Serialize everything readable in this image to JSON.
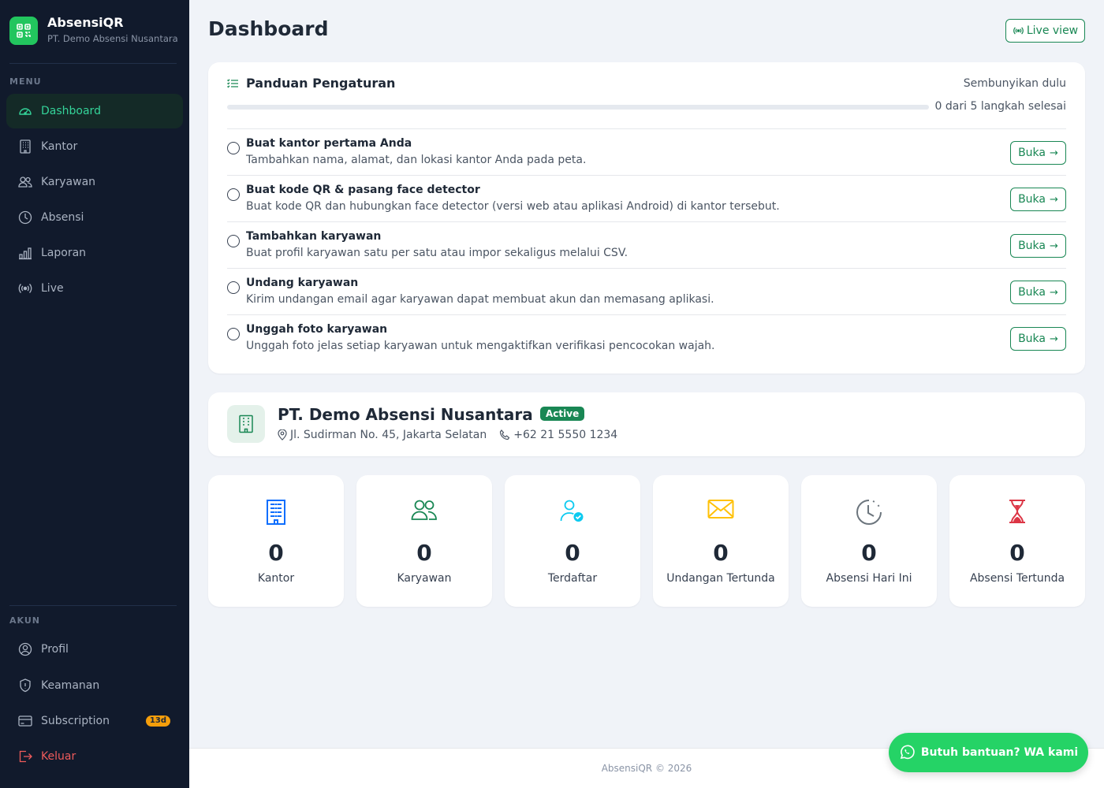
{
  "brand": {
    "name": "AbsensiQR",
    "company": "PT. Demo Absensi Nusantara"
  },
  "sidebar": {
    "menu_label": "MENU",
    "menu": [
      {
        "label": "Dashboard",
        "icon": "speedometer-icon",
        "active": true
      },
      {
        "label": "Kantor",
        "icon": "building-icon"
      },
      {
        "label": "Karyawan",
        "icon": "people-icon"
      },
      {
        "label": "Absensi",
        "icon": "clock-icon"
      },
      {
        "label": "Laporan",
        "icon": "bar-chart-icon"
      },
      {
        "label": "Live",
        "icon": "broadcast-icon"
      }
    ],
    "account_label": "AKUN",
    "account": [
      {
        "label": "Profil",
        "icon": "user-circle-icon"
      },
      {
        "label": "Keamanan",
        "icon": "shield-icon"
      },
      {
        "label": "Subscription",
        "icon": "credit-card-icon",
        "badge": "13d"
      },
      {
        "label": "Keluar",
        "icon": "logout-icon"
      }
    ]
  },
  "header": {
    "title": "Dashboard",
    "live_view_label": "Live view"
  },
  "guide": {
    "title": "Panduan Pengaturan",
    "hide_label": "Sembunyikan dulu",
    "progress_text": "0 dari 5 langkah selesai",
    "progress_fraction": 0,
    "open_label": "Buka",
    "steps": [
      {
        "title": "Buat kantor pertama Anda",
        "desc": "Tambahkan nama, alamat, dan lokasi kantor Anda pada peta."
      },
      {
        "title": "Buat kode QR & pasang face detector",
        "desc": "Buat kode QR dan hubungkan face detector (versi web atau aplikasi Android) di kantor tersebut."
      },
      {
        "title": "Tambahkan karyawan",
        "desc": "Buat profil karyawan satu per satu atau impor sekaligus melalui CSV."
      },
      {
        "title": "Undang karyawan",
        "desc": "Kirim undangan email agar karyawan dapat membuat akun dan memasang aplikasi."
      },
      {
        "title": "Unggah foto karyawan",
        "desc": "Unggah foto jelas setiap karyawan untuk mengaktifkan verifikasi pencocokan wajah."
      }
    ]
  },
  "company": {
    "name": "PT. Demo Absensi Nusantara",
    "status": "Active",
    "address": "Jl. Sudirman No. 45, Jakarta Selatan",
    "phone": "+62 21 5550 1234"
  },
  "stats": [
    {
      "value": "0",
      "label": "Kantor",
      "icon": "building-icon",
      "color": "#0d6efd"
    },
    {
      "value": "0",
      "label": "Karyawan",
      "icon": "people-icon",
      "color": "#198754"
    },
    {
      "value": "0",
      "label": "Terdaftar",
      "icon": "person-check-icon",
      "color": "#0dcaf0"
    },
    {
      "value": "0",
      "label": "Undangan Tertunda",
      "icon": "envelope-icon",
      "color": "#ffc107"
    },
    {
      "value": "0",
      "label": "Absensi Hari Ini",
      "icon": "clock-history-icon",
      "color": "#6c757d"
    },
    {
      "value": "0",
      "label": "Absensi Tertunda",
      "icon": "hourglass-icon",
      "color": "#dc3545"
    }
  ],
  "footer": {
    "text": "AbsensiQR © 2026"
  },
  "help_button": {
    "label": "Butuh bantuan? WA kami"
  },
  "colors": {
    "accent": "#198754",
    "sidebar": "#111a2c",
    "whatsapp": "#25d366",
    "badge": "#f59e0b"
  }
}
